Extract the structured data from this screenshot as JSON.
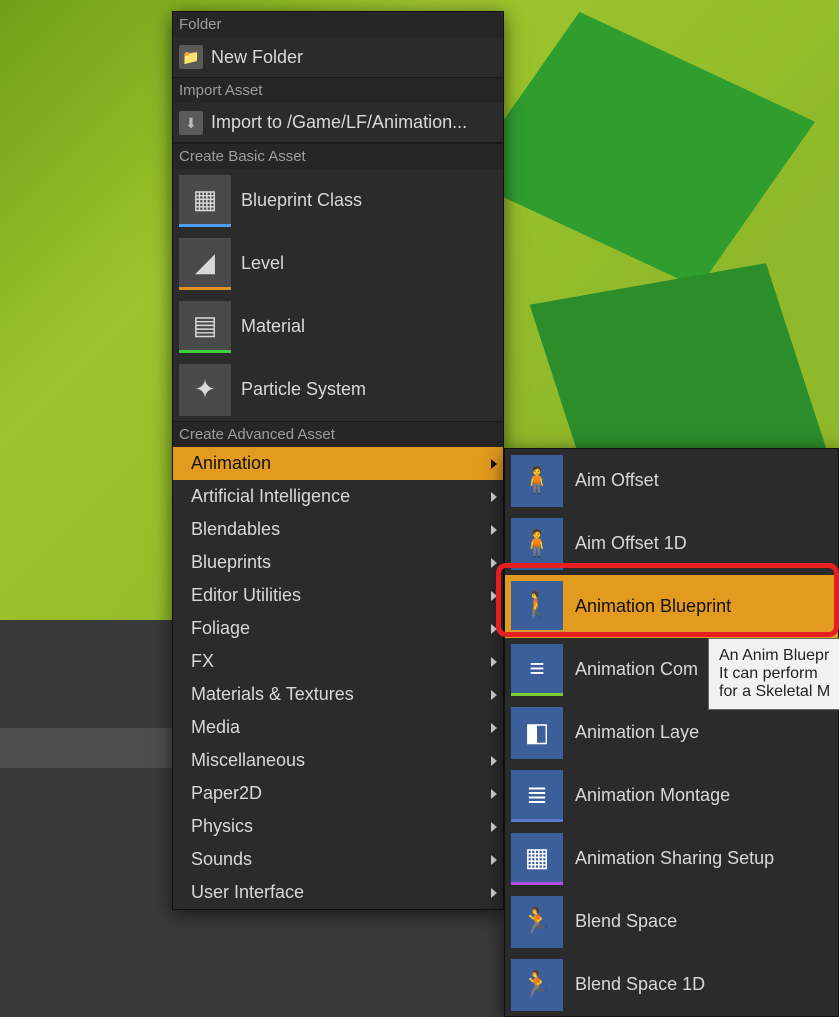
{
  "sections": {
    "folder": {
      "header": "Folder",
      "new_folder": "New Folder"
    },
    "import": {
      "header": "Import Asset",
      "label": "Import to /Game/LF/Animation..."
    },
    "basic": {
      "header": "Create Basic Asset",
      "items": {
        "blueprint_class": "Blueprint Class",
        "level": "Level",
        "material": "Material",
        "particle_system": "Particle System"
      }
    },
    "advanced": {
      "header": "Create Advanced Asset",
      "items": {
        "animation": "Animation",
        "ai": "Artificial Intelligence",
        "blendables": "Blendables",
        "blueprints": "Blueprints",
        "editor_utilities": "Editor Utilities",
        "foliage": "Foliage",
        "fx": "FX",
        "materials_textures": "Materials & Textures",
        "media": "Media",
        "miscellaneous": "Miscellaneous",
        "paper2d": "Paper2D",
        "physics": "Physics",
        "sounds": "Sounds",
        "user_interface": "User Interface"
      }
    }
  },
  "submenu": {
    "items": {
      "aim_offset": "Aim Offset",
      "aim_offset_1d": "Aim Offset 1D",
      "animation_blueprint": "Animation Blueprint",
      "animation_composite": "Animation Com",
      "animation_layer": "Animation Laye",
      "animation_montage": "Animation Montage",
      "animation_sharing_setup": "Animation Sharing Setup",
      "blend_space": "Blend Space",
      "blend_space_1d": "Blend Space 1D"
    }
  },
  "tooltip": {
    "line1": "An Anim Bluepr",
    "line2": "It can perform ",
    "line3": "for a Skeletal M"
  }
}
